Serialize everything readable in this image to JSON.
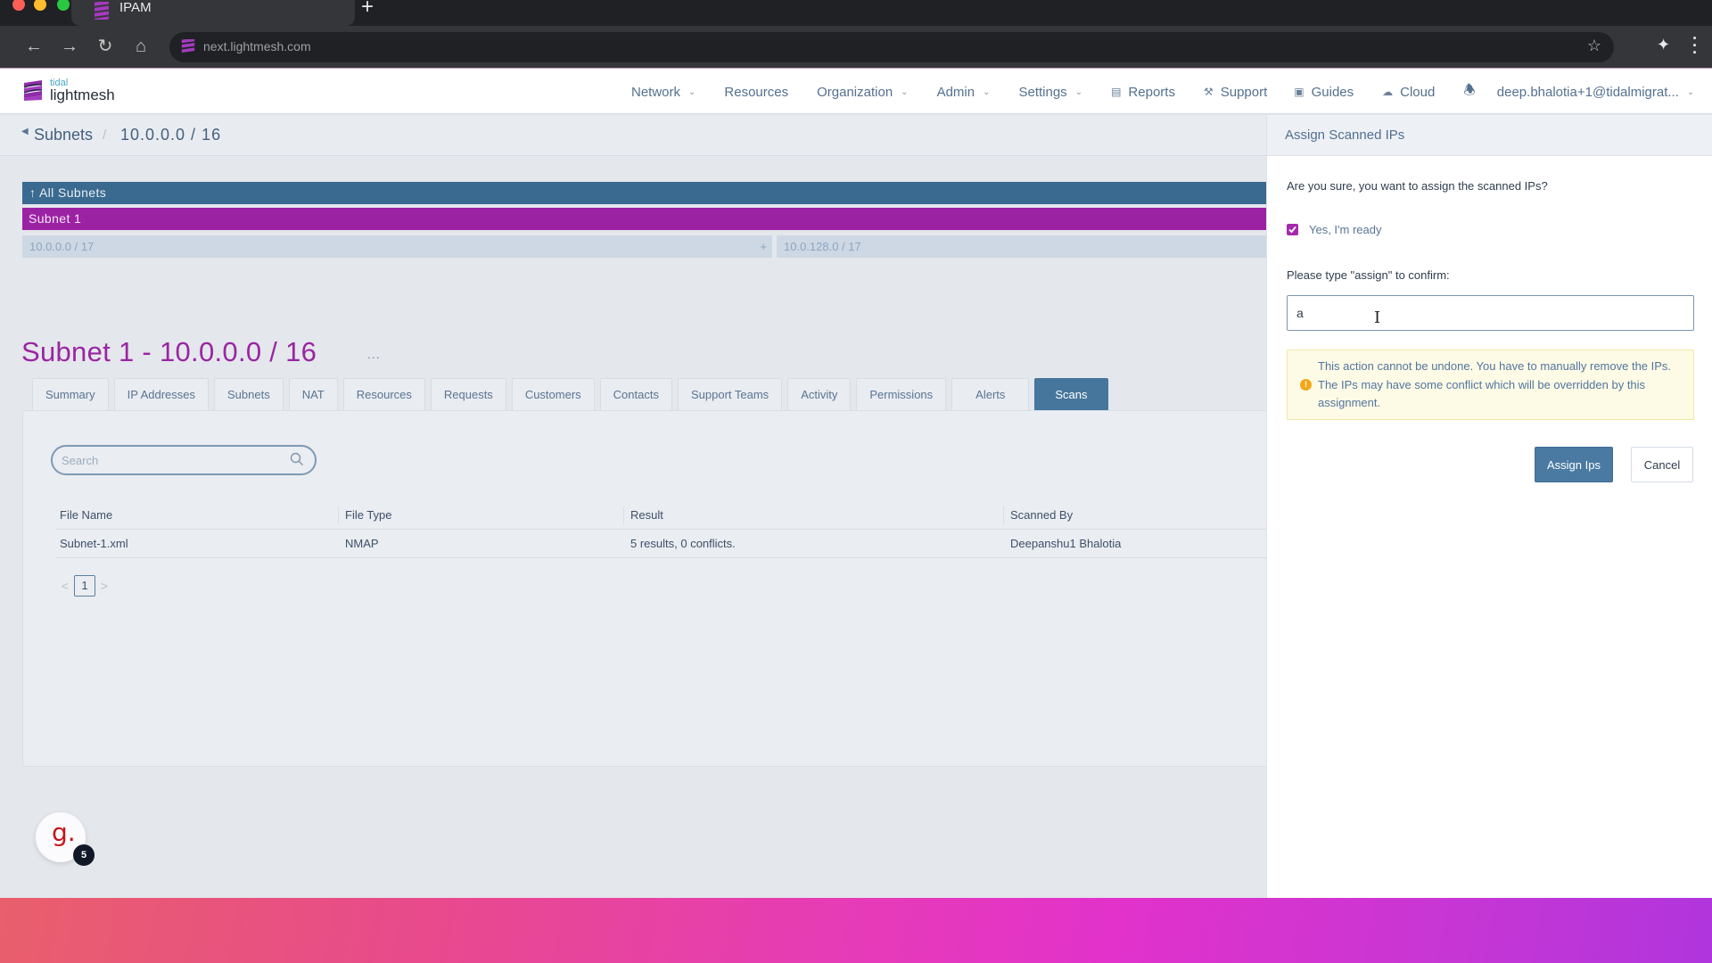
{
  "browser": {
    "tab_title": "IPAM",
    "new_tab_label": "+",
    "url": "next.lightmesh.com",
    "icons": {
      "back": "arrow-left-icon",
      "forward": "arrow-right-icon",
      "reload": "reload-icon",
      "home": "home-icon",
      "bookmark": "star-icon",
      "extensions": "puzzle-icon",
      "menu": "kebab-menu-icon"
    }
  },
  "app": {
    "logo": {
      "small": "tidal",
      "big": "lightmesh"
    },
    "nav": [
      {
        "label": "Network",
        "dropdown": true
      },
      {
        "label": "Resources",
        "dropdown": false
      },
      {
        "label": "Organization",
        "dropdown": true
      },
      {
        "label": "Admin",
        "dropdown": true
      },
      {
        "label": "Settings",
        "dropdown": true
      },
      {
        "label": "Reports",
        "icon": "bar-chart-icon"
      },
      {
        "label": "Support",
        "icon": "wrench-icon"
      },
      {
        "label": "Guides",
        "icon": "book-icon"
      },
      {
        "label": "Cloud",
        "icon": "cloud-icon"
      }
    ],
    "notifications_icon": "bell-icon",
    "user": "deep.bhalotia+1@tidalmigrat..."
  },
  "breadcrumb": {
    "root": "Subnets",
    "separator": "/",
    "current": "10.0.0.0 / 16"
  },
  "subnet_tree": {
    "all_label": "All Subnets",
    "current_label": "Subnet 1",
    "children": [
      "10.0.0.0 / 17",
      "10.0.128.0 / 17"
    ],
    "add_label": "+"
  },
  "page": {
    "title": "Subnet 1 - 10.0.0.0 / 16",
    "more_label": "...",
    "tabs": [
      "Summary",
      "IP Addresses",
      "Subnets",
      "NAT",
      "Resources",
      "Requests",
      "Customers",
      "Contacts",
      "Support Teams",
      "Activity",
      "Permissions",
      "Alerts",
      "Scans"
    ],
    "active_tab": "Scans"
  },
  "scans": {
    "search_placeholder": "Search",
    "columns": [
      "File Name",
      "File Type",
      "Result",
      "Scanned By"
    ],
    "rows": [
      {
        "file_name": "Subnet-1.xml",
        "file_type": "NMAP",
        "result": "5 results, 0 conflicts.",
        "scanned_by": "Deepanshu1 Bhalotia"
      }
    ],
    "pagination": {
      "prev": "<",
      "current_page": "1",
      "next": ">"
    }
  },
  "assign_panel": {
    "title": "Assign Scanned IPs",
    "question": "Are you sure, you want to assign the scanned IPs?",
    "checkbox_label": "Yes, I'm ready",
    "checkbox_checked": true,
    "confirm_label": "Please type \"assign\" to confirm:",
    "confirm_value": "a",
    "warning": "This action cannot be undone. You have to manually remove the IPs. The IPs may have some conflict which will be overridden by this assignment.",
    "assign_button": "Assign Ips",
    "cancel_button": "Cancel"
  },
  "widget": {
    "glyph": "g.",
    "badge_count": "5"
  },
  "colors": {
    "brand_purple": "#9c22a4",
    "primary_blue": "#46769c",
    "warning_bg": "#fdfbe5",
    "warning_icon": "#f1a91a"
  }
}
